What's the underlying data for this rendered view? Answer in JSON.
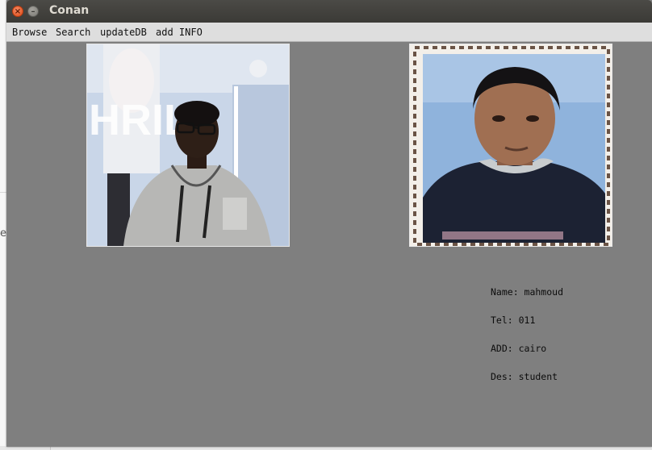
{
  "window": {
    "title": "Conan"
  },
  "menu": {
    "items": [
      "Browse",
      "Search",
      "updateDB",
      "add INFO"
    ]
  },
  "photos": {
    "query_photo_icon": "person-photo-icon",
    "match_photo_icon": "child-portrait-icon"
  },
  "info": {
    "name": "Name: mahmoud",
    "tel": "Tel: 011",
    "add": "ADD: cairo",
    "des": "Des: student"
  },
  "background": {
    "side_glyph": "e"
  },
  "colors": {
    "window_bg": "#7f7f7f",
    "titlebar": "#3c3b37",
    "menubar": "#dedede",
    "close_button": "#df4a16"
  }
}
